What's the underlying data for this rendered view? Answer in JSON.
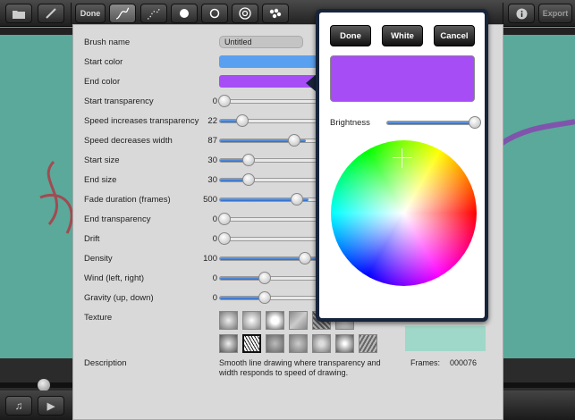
{
  "toolbar": {
    "done_label": "Done",
    "export_label": "Export",
    "info_icon": "info-icon",
    "folder_icon": "folder-icon",
    "brush_icon": "brush-icon"
  },
  "brush": {
    "name_label": "Brush name",
    "name_value": "Untitled",
    "start_color_label": "Start color",
    "start_color": "#5aa0f0",
    "end_color_label": "End color",
    "end_color": "#a64df5",
    "settings": [
      {
        "label": "Start transparency",
        "value": "0",
        "level": 0.0
      },
      {
        "label": "Speed increases transparency",
        "value": "22",
        "level": 0.22
      },
      {
        "label": "Speed decreases width",
        "value": "87",
        "level": 0.87
      },
      {
        "label": "Start size",
        "value": "30",
        "level": 0.3
      },
      {
        "label": "End size",
        "value": "30",
        "level": 0.3
      },
      {
        "label": "Fade duration (frames)",
        "value": "500",
        "level": 0.9
      },
      {
        "label": "End transparency",
        "value": "0",
        "level": 0.0
      },
      {
        "label": "Drift",
        "value": "0",
        "level": 0.0
      },
      {
        "label": "Density",
        "value": "100",
        "level": 1.0
      },
      {
        "label": "Wind (left, right)",
        "value": "0",
        "level": 0.5
      },
      {
        "label": "Gravity (up, down)",
        "value": "0",
        "level": 0.5
      }
    ],
    "texture_label": "Texture",
    "description_label": "Description",
    "description_text": "Smooth line drawing where transparency and width responds to speed of drawing.",
    "frames_label": "Frames:",
    "frames_value": "000076"
  },
  "color_picker": {
    "done_label": "Done",
    "white_label": "White",
    "cancel_label": "Cancel",
    "selected_color": "#a64df5",
    "brightness_label": "Brightness",
    "brightness_level": 1.0
  }
}
